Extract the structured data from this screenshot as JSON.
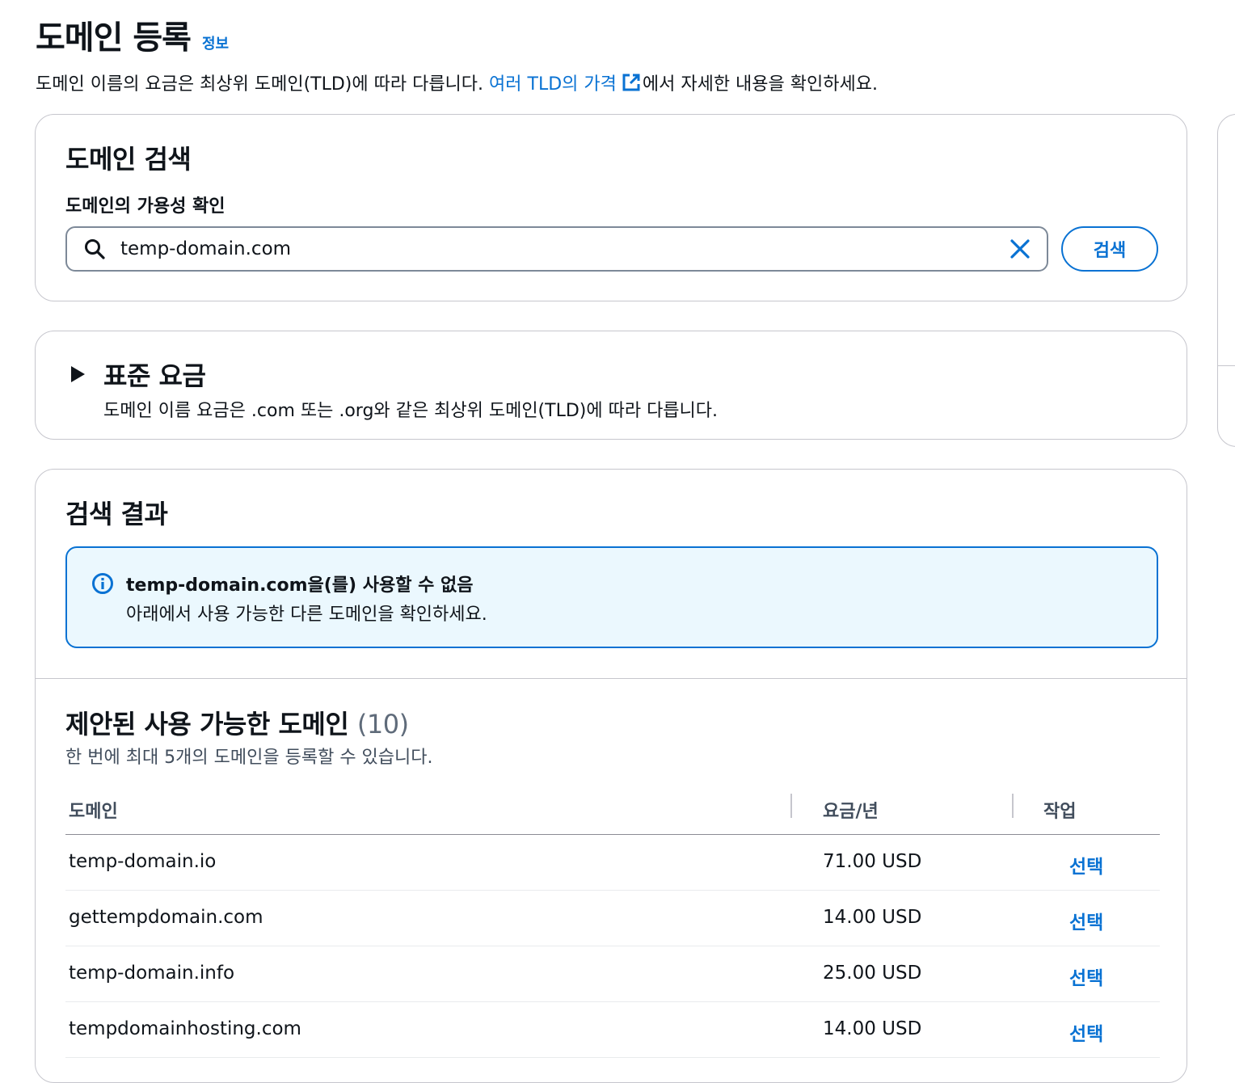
{
  "header": {
    "title": "도메인 등록",
    "info_link": "정보",
    "desc_prefix": "도메인 이름의 요금은 최상위 도메인(TLD)에 따라 다릅니다. ",
    "desc_link": "여러 TLD의 가격",
    "desc_suffix": "에서 자세한 내용을 확인하세요."
  },
  "search": {
    "title": "도메인 검색",
    "label": "도메인의 가용성 확인",
    "value": "temp-domain.com",
    "button": "검색"
  },
  "pricing": {
    "title": "표준 요금",
    "desc": "도메인 이름 요금은 .com 또는 .org와 같은 최상위 도메인(TLD)에 따라 다릅니다."
  },
  "results": {
    "title": "검색 결과",
    "alert_title": "temp-domain.com을(를) 사용할 수 없음",
    "alert_body": "아래에서 사용 가능한 다른 도메인을 확인하세요.",
    "suggested_title": "제안된 사용 가능한 도메인",
    "suggested_count": "(10)",
    "suggested_desc": "한 번에 최대 5개의 도메인을 등록할 수 있습니다.",
    "columns": {
      "domain": "도메인",
      "price": "요금/년",
      "action": "작업"
    },
    "rows": [
      {
        "domain": "temp-domain.io",
        "price": "71.00 USD",
        "action": "선택"
      },
      {
        "domain": "gettempdomain.com",
        "price": "14.00 USD",
        "action": "선택"
      },
      {
        "domain": "temp-domain.info",
        "price": "25.00 USD",
        "action": "선택"
      },
      {
        "domain": "tempdomainhosting.com",
        "price": "14.00 USD",
        "action": "선택"
      }
    ]
  },
  "colors": {
    "accent": "#0972d3",
    "alert_bg": "#ebf8fe",
    "border": "#c6c6cd"
  },
  "icons": [
    "external-link-icon",
    "search-icon",
    "clear-icon",
    "caret-right-icon",
    "info-icon"
  ]
}
